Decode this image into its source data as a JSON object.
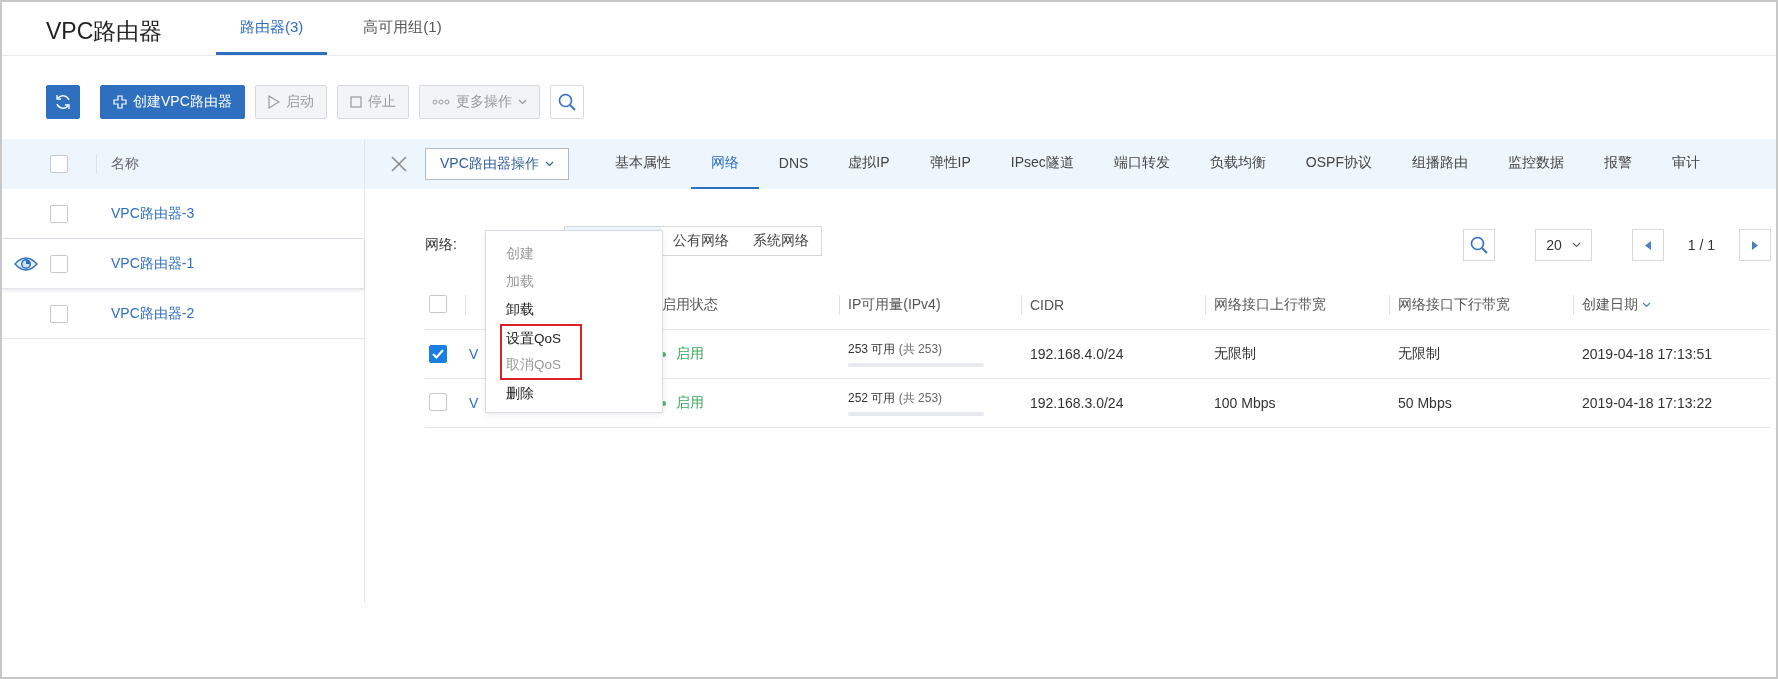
{
  "title": "VPC路由器",
  "tabs": [
    {
      "label": "路由器(3)",
      "selected": true
    },
    {
      "label": "高可用组(1)",
      "selected": false
    }
  ],
  "toolbar": [
    {
      "kind": "refresh",
      "disabled": false
    },
    {
      "kind": "create",
      "label": "创建VPC路由器",
      "disabled": false
    },
    {
      "kind": "start",
      "label": "启动",
      "disabled": true
    },
    {
      "kind": "stop",
      "label": "停止",
      "disabled": true
    },
    {
      "kind": "more",
      "label": "更多操作",
      "disabled": true
    },
    {
      "kind": "search",
      "disabled": false
    }
  ],
  "list": {
    "header": "名称",
    "all_checked": false,
    "rows": [
      {
        "name": "VPC路由器-3",
        "selected": false,
        "checked": false
      },
      {
        "name": "VPC路由器-1",
        "selected": true,
        "checked": false
      },
      {
        "name": "VPC路由器-2",
        "selected": false,
        "checked": false
      }
    ]
  },
  "detail": {
    "actions_label": "VPC路由器操作",
    "tabs": [
      {
        "label": "基本属性",
        "selected": false
      },
      {
        "label": "网络",
        "selected": true
      },
      {
        "label": "DNS",
        "selected": false
      },
      {
        "label": "虚拟IP",
        "selected": false
      },
      {
        "label": "弹性IP",
        "selected": false
      },
      {
        "label": "IPsec隧道",
        "selected": false
      },
      {
        "label": "端口转发",
        "selected": false
      },
      {
        "label": "负载均衡",
        "selected": false
      },
      {
        "label": "OSPF协议",
        "selected": false
      },
      {
        "label": "组播路由",
        "selected": false
      },
      {
        "label": "监控数据",
        "selected": false
      },
      {
        "label": "报警",
        "selected": false
      },
      {
        "label": "审计",
        "selected": false
      }
    ],
    "network_label": "网络:",
    "segments": [
      {
        "label": "公有网络",
        "selected": false
      },
      {
        "label": "系统网络",
        "selected": false
      }
    ],
    "page_size": "20",
    "page": "1 / 1",
    "table": {
      "all_checked": false,
      "columns": [
        "",
        "启用状态",
        "IP可用量(IPv4)",
        "CIDR",
        "网络接口上行带宽",
        "网络接口下行带宽",
        "创建日期"
      ],
      "rows": [
        {
          "checked": true,
          "name": "V",
          "status": "启用",
          "ip_available": "253 可用",
          "ip_total": "(共 253)",
          "cidr": "192.168.4.0/24",
          "up": "无限制",
          "down": "无限制",
          "created": "2019-04-18 17:13:51"
        },
        {
          "checked": false,
          "name": "V",
          "status": "启用",
          "ip_available": "252 可用",
          "ip_total": "(共 253)",
          "cidr": "192.168.3.0/24",
          "up": "100 Mbps",
          "down": "50 Mbps",
          "created": "2019-04-18 17:13:22"
        }
      ]
    },
    "menu": [
      {
        "label": "创建",
        "disabled": true,
        "highlighted": false
      },
      {
        "label": "加载",
        "disabled": true,
        "highlighted": false
      },
      {
        "label": "卸载",
        "disabled": false,
        "highlighted": false
      },
      {
        "label": "设置QoS",
        "disabled": false,
        "highlighted": true
      },
      {
        "label": "取消QoS",
        "disabled": true,
        "highlighted": true
      },
      {
        "label": "删除",
        "disabled": false,
        "highlighted": false
      }
    ]
  }
}
